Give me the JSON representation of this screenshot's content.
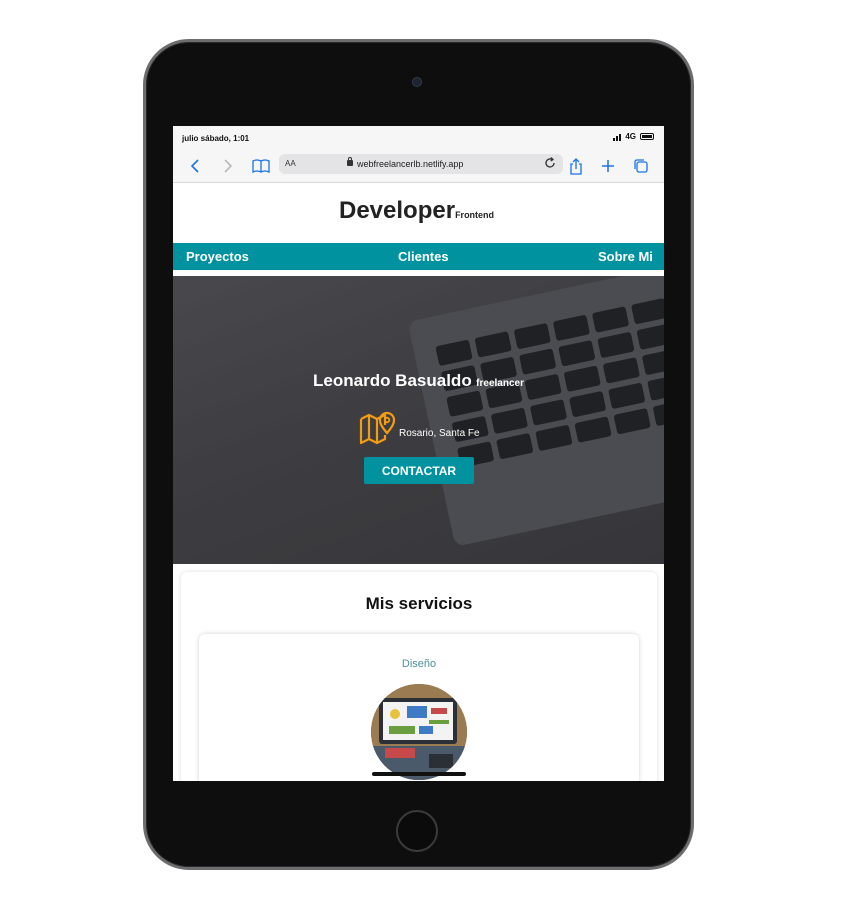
{
  "status_bar": {
    "time": "julio sábado, 1:01",
    "network": "4G"
  },
  "browser": {
    "text_size_label": "AA",
    "url": "webfreelancerlb.netlify.app"
  },
  "site": {
    "logo_main": "Developer",
    "logo_sub": "Frontend",
    "nav": [
      "Proyectos",
      "Clientes",
      "Sobre Mi"
    ],
    "hero": {
      "name": "Leonardo Basualdo",
      "role": "freelancer",
      "location": "Rosario, Santa Fe",
      "cta": "CONTACTAR"
    },
    "services": {
      "title": "Mis servicios",
      "cards": [
        {
          "label": "Diseño"
        }
      ]
    }
  },
  "colors": {
    "accent": "#00939f",
    "location_icon": "#f39c12",
    "card_label": "#4b8f99"
  }
}
